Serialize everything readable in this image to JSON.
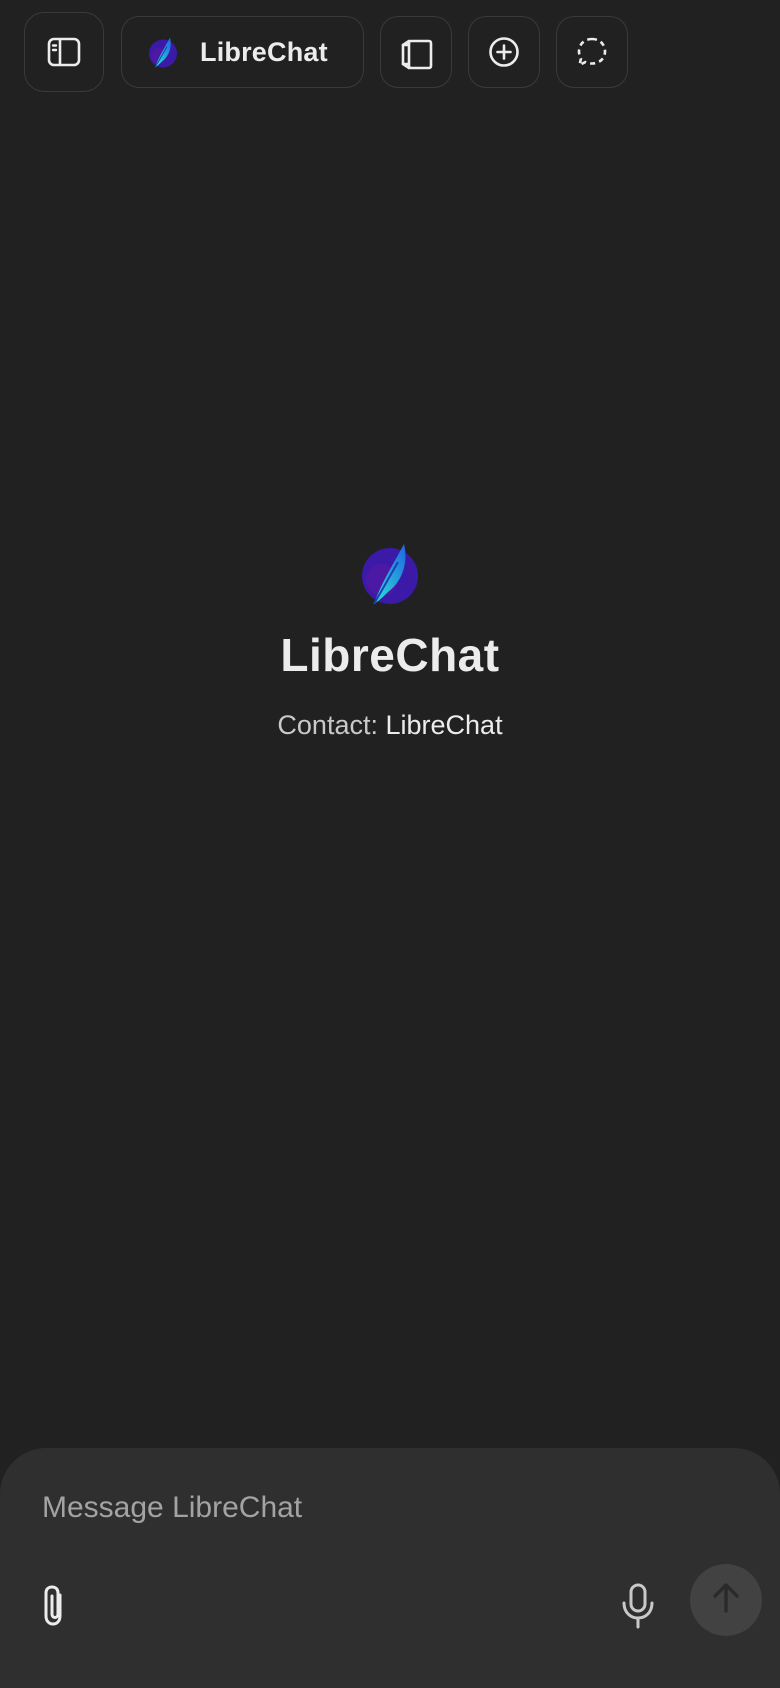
{
  "header": {
    "model_name": "LibreChat",
    "icons": {
      "sidebar": "sidebar-toggle-icon",
      "model": "librechat-feather-logo",
      "bookmarks": "bookmarks-icon",
      "new_chat": "plus-circle-icon",
      "temporary_chat": "dashed-chat-bubble-icon"
    }
  },
  "landing": {
    "title": "LibreChat",
    "contact_label": "Contact:",
    "contact_name": "LibreChat"
  },
  "composer": {
    "placeholder": "Message LibreChat",
    "value": "",
    "icons": {
      "attach": "paperclip-icon",
      "mic": "microphone-icon",
      "send": "arrow-up-icon"
    }
  },
  "colors": {
    "background": "#212121",
    "composer_background": "#2f2f2f",
    "send_button": "#424242",
    "text_primary": "#ececec",
    "text_placeholder": "#a3a3a3",
    "logo_circle": "#3b1aa8",
    "logo_feather_light": "#2ec9e8",
    "logo_feather_dark": "#1f66e0"
  }
}
